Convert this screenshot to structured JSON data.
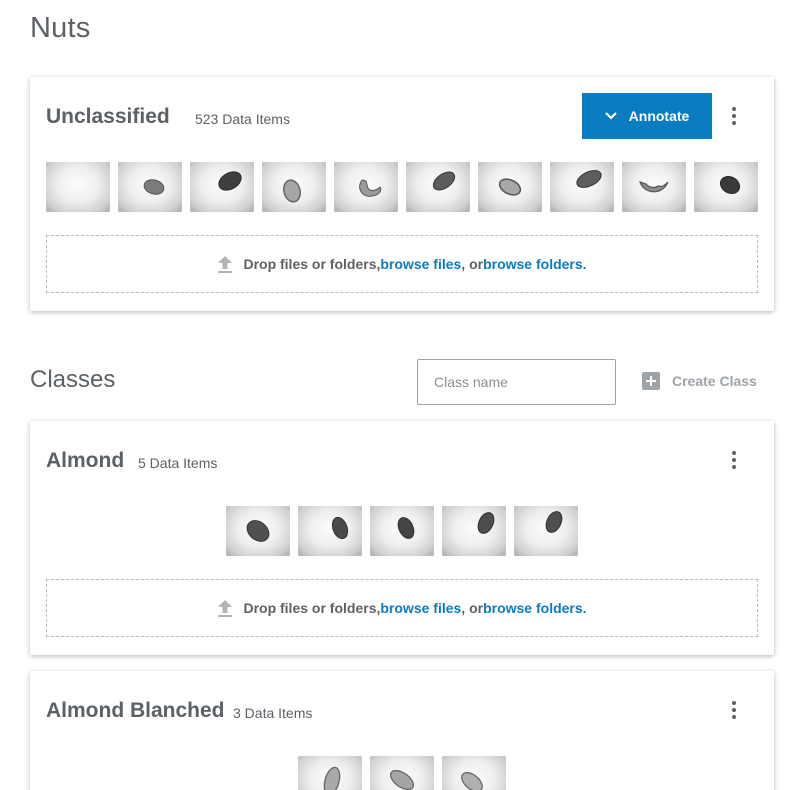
{
  "page": {
    "title": "Nuts"
  },
  "unclassified": {
    "title": "Unclassified",
    "count": "523 Data Items",
    "annotate_label": "Annotate",
    "thumbnails": [
      "blank",
      "almond-small",
      "almond-dark",
      "pistachio",
      "cashew",
      "almond",
      "hazelnut",
      "almond-flat",
      "cashew-open",
      "almond-round"
    ]
  },
  "dropzone": {
    "prefix": "Drop files or folders, ",
    "browse_files": "browse files",
    "middle": ", or ",
    "browse_folders": "browse folders."
  },
  "classes": {
    "title": "Classes",
    "input_placeholder": "Class name",
    "create_label": "Create Class",
    "items": [
      {
        "title": "Almond",
        "count": "5 Data Items"
      },
      {
        "title": "Almond Blanched",
        "count": "3 Data Items"
      }
    ]
  },
  "icons": {
    "chevron": "chevron-down-icon",
    "kebab": "more-vert-icon",
    "upload": "upload-icon",
    "plus": "plus-box-icon"
  },
  "colors": {
    "accent": "#0a7cc1",
    "text": "#5c6166",
    "muted": "#9ea3a8"
  }
}
